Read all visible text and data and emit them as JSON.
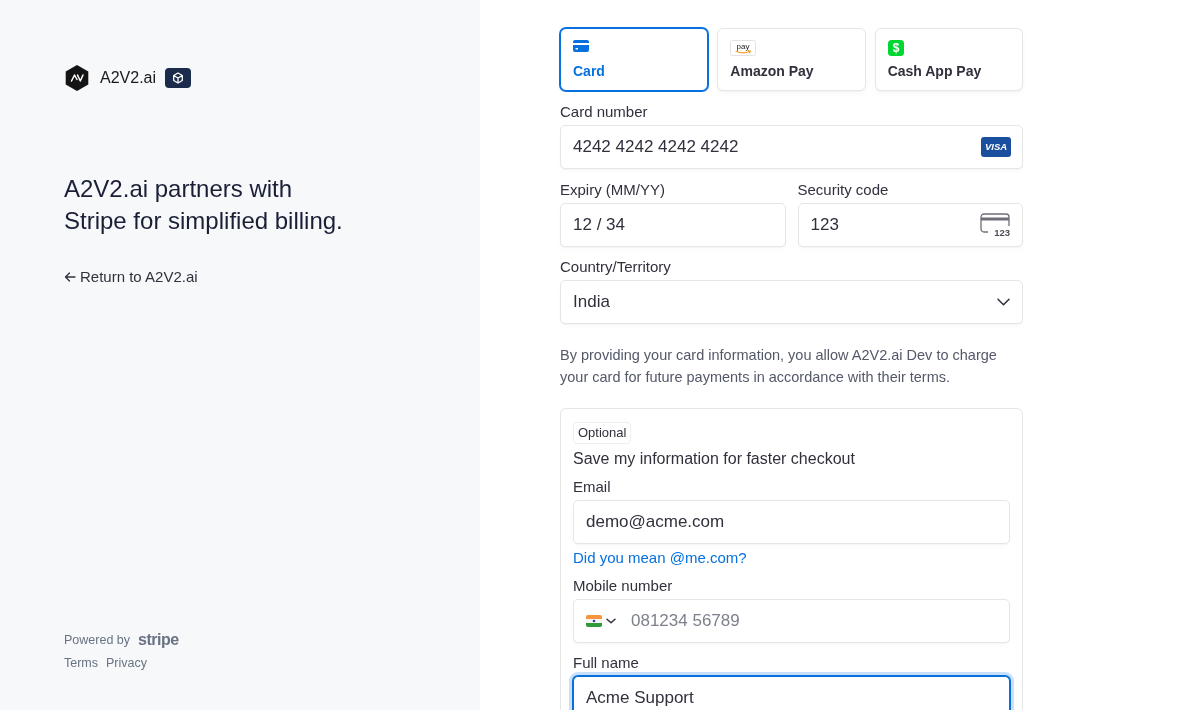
{
  "brand": {
    "name": "A2V2.ai"
  },
  "headline": "A2V2.ai partners with Stripe for simplified billing.",
  "back_link": {
    "label": "Return to A2V2.ai"
  },
  "footer": {
    "powered_by": "Powered by",
    "logo": "stripe",
    "links": [
      "Terms",
      "Privacy"
    ]
  },
  "payment_methods": [
    {
      "kind": "card",
      "label": "Card",
      "selected": true
    },
    {
      "kind": "amazon_pay",
      "label": "Amazon Pay",
      "logo_text": "pay",
      "selected": false
    },
    {
      "kind": "cash_app",
      "label": "Cash App Pay",
      "logo_text": "$",
      "selected": false
    }
  ],
  "card_form": {
    "card_number": {
      "label": "Card number",
      "value": "4242 4242 4242 4242",
      "brand": "VISA",
      "focused": false
    },
    "expiry": {
      "label": "Expiry (MM/YY)",
      "value": "12 / 34",
      "focused": false
    },
    "security_code": {
      "label": "Security code",
      "value": "123",
      "icon_text": "123",
      "focused": false
    },
    "country": {
      "label": "Country/Territory",
      "value": "India",
      "focused": false
    },
    "consent": "By providing your card information, you allow A2V2.ai Dev to charge your card for future payments in accordance with their terms."
  },
  "save_info": {
    "badge": "Optional",
    "title": "Save my information for faster checkout",
    "email": {
      "label": "Email",
      "value": "demo@acme.com",
      "focused": false
    },
    "suggestion": "Did you mean @me.com?",
    "mobile": {
      "label": "Mobile number",
      "placeholder": "081234 56789",
      "focused": false
    },
    "full_name": {
      "label": "Full name",
      "value": "Acme Support",
      "focused": true
    }
  }
}
